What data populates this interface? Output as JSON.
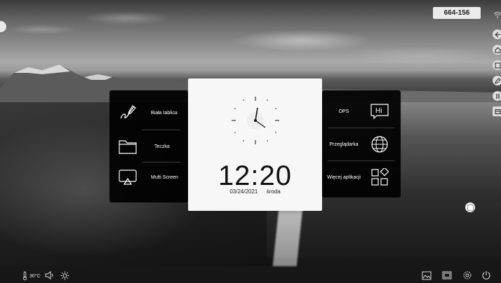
{
  "badge": {
    "id_text": "664-156"
  },
  "left_panel": {
    "items": [
      {
        "label": "Biała tablica",
        "icon": "pen-signature-icon"
      },
      {
        "label": "Teczka",
        "icon": "folder-icon"
      },
      {
        "label": "Multi Screen",
        "icon": "screen-cast-icon"
      }
    ]
  },
  "right_panel": {
    "items": [
      {
        "label": "OPS",
        "icon": "hi-chat-bubble-icon",
        "icon_text": "Hi"
      },
      {
        "label": "Przeglądarka",
        "icon": "globe-icon"
      },
      {
        "label": "Więcej aplikacji",
        "icon": "apps-grid-icon"
      }
    ]
  },
  "clock": {
    "time": "12:20",
    "date": "03/24/2021",
    "weekday": "środa"
  },
  "status_bar": {
    "temperature": "30°C"
  },
  "side_toolbar": {
    "icons": [
      "wifi-icon",
      "back-icon",
      "home-icon",
      "window-icon",
      "pen-icon",
      "split-icon",
      "screen-icon"
    ]
  },
  "bottom_toolbar": {
    "icons": [
      "gallery-icon",
      "window-switch-icon",
      "settings-icon",
      "power-icon"
    ]
  },
  "colors": {
    "panel": "#000000",
    "card": "#f7f7f7",
    "text_light": "#ffffff",
    "text_dark": "#111111"
  }
}
